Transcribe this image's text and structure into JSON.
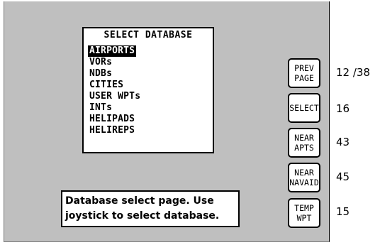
{
  "database_panel": {
    "title": "SELECT DATABASE",
    "items": [
      {
        "label": "AIRPORTS",
        "selected": true
      },
      {
        "label": "VORs",
        "selected": false
      },
      {
        "label": "NDBs",
        "selected": false
      },
      {
        "label": "CITIES",
        "selected": false
      },
      {
        "label": "USER WPTs",
        "selected": false
      },
      {
        "label": "INTs",
        "selected": false
      },
      {
        "label": "HELIPADS",
        "selected": false
      },
      {
        "label": "HELIREPS",
        "selected": false
      }
    ]
  },
  "message": {
    "line1": "Database select page. Use",
    "line2": "joystick to select database."
  },
  "softkeys": [
    {
      "line1": "PREV",
      "line2": "PAGE",
      "value": "12 /38"
    },
    {
      "line1": "SELECT",
      "line2": "",
      "value": "16"
    },
    {
      "line1": "NEAR",
      "line2": "APTS",
      "value": "43"
    },
    {
      "line1": "NEAR",
      "line2": "NAVAID",
      "value": "45"
    },
    {
      "line1": "TEMP",
      "line2": "WPT",
      "value": "15"
    }
  ]
}
